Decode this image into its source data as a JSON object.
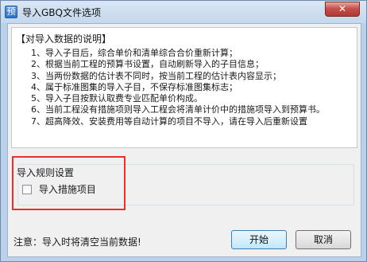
{
  "window": {
    "icon_glyph": "预",
    "title": "导入GBQ文件选项",
    "close_glyph": "✕"
  },
  "description": {
    "heading": "【对导入数据的说明】",
    "items": [
      "1、导入子目后，综合单价和清单综合合价重新计算；",
      "2、根据当前工程的预算书设置，自动刷新导入的子目信息；",
      "3、当两份数据的估计表不同时，按当前工程的估计表内容显示；",
      "4、属于标准图集的导入子目，不保存标准图集标志；",
      "5、导入子目按默认取费专业匹配单价构成。",
      "6、当前工程没有措施项则导入工程会将清单计价中的措施项导入到预算书。",
      "7、超高降效、安装费用等自动计算的项目不导入，请在导入后重新设置"
    ]
  },
  "import_rules": {
    "legend": "导入规则设置",
    "checkbox_label": "导入措施项目",
    "checked": false
  },
  "footer": {
    "note": "注意：导入时将清空当前数据!",
    "start_label": "开始",
    "cancel_label": "取消"
  },
  "colors": {
    "highlight_outline": "#e8302c",
    "titlebar": "#c4d7ec",
    "dialog_face": "#f0f0f0"
  },
  "icons": {
    "app": "app-icon",
    "close": "close-icon"
  }
}
